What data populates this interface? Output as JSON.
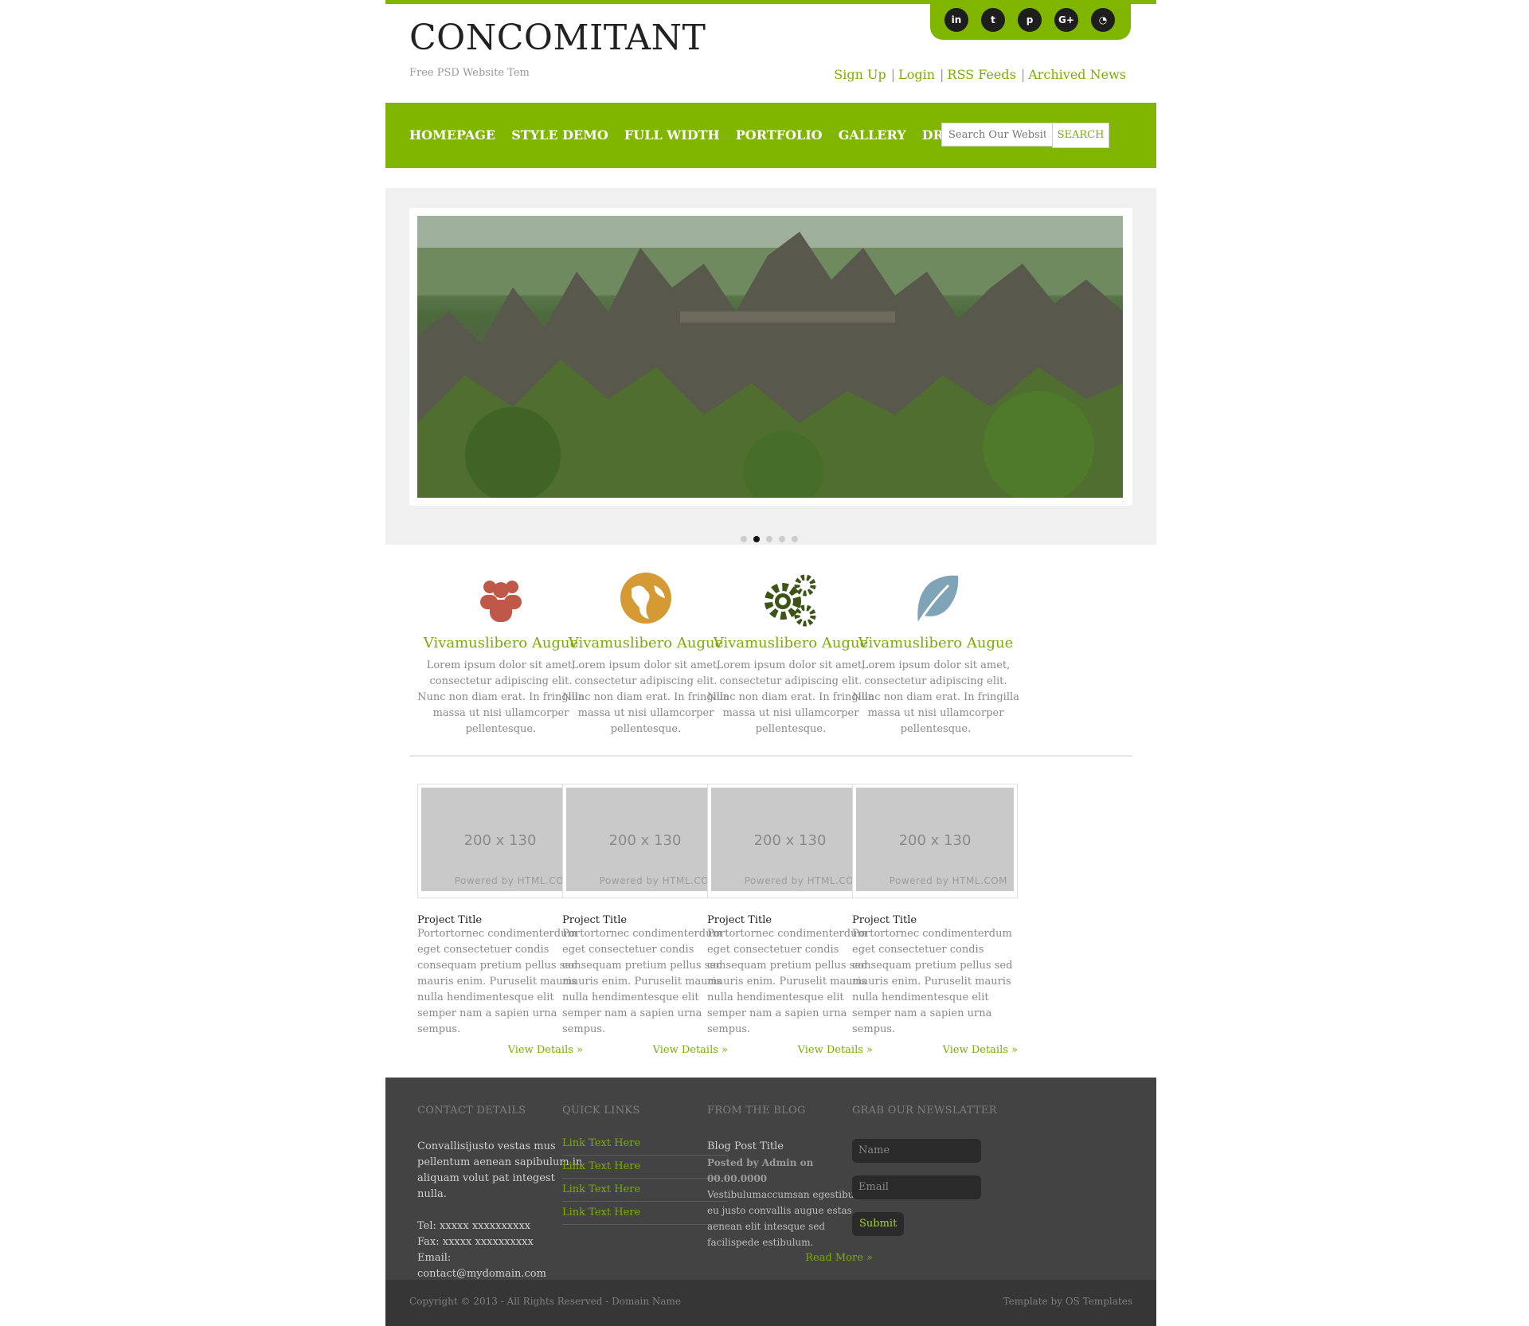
{
  "brand": {
    "logo": "CONCOMITANT",
    "tagline": "Free PSD Website Tem"
  },
  "social": [
    {
      "icon": "linkedin-icon",
      "glyph": "in"
    },
    {
      "icon": "twitter-icon",
      "glyph": "t"
    },
    {
      "icon": "pinterest-icon",
      "glyph": "p"
    },
    {
      "icon": "google-plus-icon",
      "glyph": "G+"
    },
    {
      "icon": "rss-icon",
      "glyph": "◔"
    }
  ],
  "toplinks": [
    "Sign Up",
    "Login",
    "RSS Feeds",
    "Archived News"
  ],
  "nav": [
    "HOMEPAGE",
    "STYLE DEMO",
    "FULL WIDTH",
    "PORTFOLIO",
    "GALLERY",
    "DROPDOWN"
  ],
  "search": {
    "placeholder": "Search Our Website...",
    "button": "SEARCH"
  },
  "slider": {
    "dots": 5,
    "active": 2
  },
  "features": [
    {
      "icon": "users-icon",
      "color": "#c0584a",
      "title": "Vivamuslibero Augue",
      "text": "Lorem ipsum dolor sit amet, consectetur adipiscing elit. Nunc non diam erat. In fringilla massa ut nisi ullamcorper pellentesque."
    },
    {
      "icon": "globe-icon",
      "color": "#d69a34",
      "title": "Vivamuslibero Augue",
      "text": "Lorem ipsum dolor sit amet, consectetur adipiscing elit. Nunc non diam erat. In fringilla massa ut nisi ullamcorper pellentesque."
    },
    {
      "icon": "gears-icon",
      "color": "#3d5417",
      "title": "Vivamuslibero Augue",
      "text": "Lorem ipsum dolor sit amet, consectetur adipiscing elit. Nunc non diam erat. In fringilla massa ut nisi ullamcorper pellentesque."
    },
    {
      "icon": "leaf-icon",
      "color": "#7fa4b7",
      "title": "Vivamuslibero Augue",
      "text": "Lorem ipsum dolor sit amet, consectetur adipiscing elit. Nunc non diam erat. In fringilla massa ut nisi ullamcorper pellentesque."
    }
  ],
  "projects": [
    {
      "dim": "200 x 130",
      "powered": "Powered by HTML.COM",
      "title": "Project Title",
      "text": "Portortornec condimenterdum eget consectetuer condis consequam pretium pellus sed mauris enim. Puruselit mauris nulla hendimentesque elit semper nam a sapien urna sempus.",
      "more": "View Details »"
    },
    {
      "dim": "200 x 130",
      "powered": "Powered by HTML.COM",
      "title": "Project Title",
      "text": "Portortornec condimenterdum eget consectetuer condis consequam pretium pellus sed mauris enim. Puruselit mauris nulla hendimentesque elit semper nam a sapien urna sempus.",
      "more": "View Details »"
    },
    {
      "dim": "200 x 130",
      "powered": "Powered by HTML.COM",
      "title": "Project Title",
      "text": "Portortornec condimenterdum eget consectetuer condis consequam pretium pellus sed mauris enim. Puruselit mauris nulla hendimentesque elit semper nam a sapien urna sempus.",
      "more": "View Details »"
    },
    {
      "dim": "200 x 130",
      "powered": "Powered by HTML.COM",
      "title": "Project Title",
      "text": "Portortornec condimenterdum eget consectetuer condis consequam pretium pellus sed mauris enim. Puruselit mauris nulla hendimentesque elit semper nam a sapien urna sempus.",
      "more": "View Details »"
    }
  ],
  "footer": {
    "contact": {
      "heading": "CONTACT DETAILS",
      "text": "Convallisijusto vestas mus pellentum aenean sapibulum in aliquam volut pat integest nulla.",
      "tel": "Tel: xxxxx xxxxxxxxxx",
      "fax": "Fax: xxxxx xxxxxxxxxx",
      "email": "Email: contact@mydomain.com"
    },
    "quick": {
      "heading": "QUICK LINKS",
      "links": [
        "Link Text Here",
        "Link Text Here",
        "Link Text Here",
        "Link Text Here"
      ]
    },
    "blog": {
      "heading": "FROM THE BLOG",
      "title": "Blog Post Title",
      "meta": "Posted by Admin on 00.00.0000",
      "text": "Vestibulumaccumsan egestibulum eu justo convallis augue estas aenean elit intesque sed facilispede estibulum.",
      "more": "Read More »"
    },
    "newsletter": {
      "heading": "GRAB OUR NEWSLATTER",
      "name": "Name",
      "email": "Email",
      "submit": "Submit"
    }
  },
  "copyright": {
    "left": "Copyright © 2013 - All Rights Reserved - Domain Name",
    "right": "Template by OS Templates"
  }
}
